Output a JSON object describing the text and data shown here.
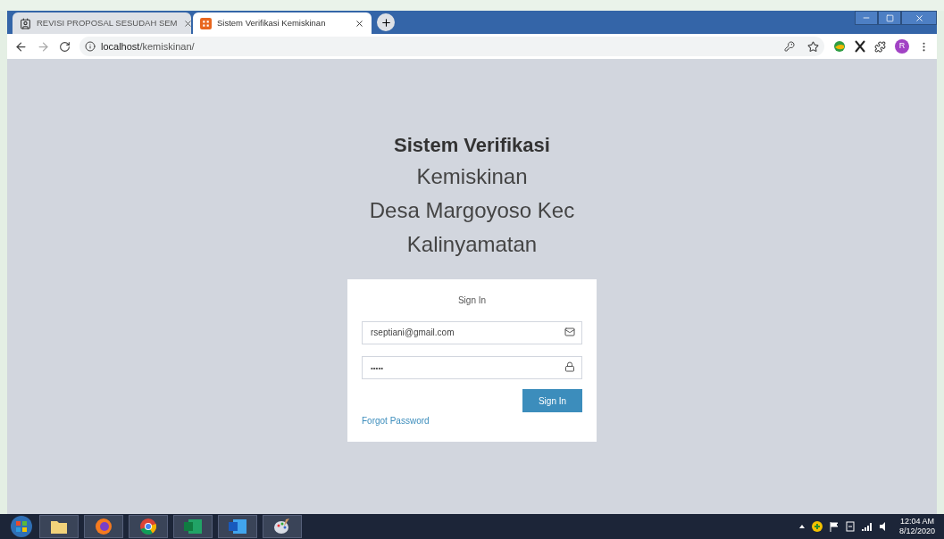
{
  "browser": {
    "tabs": [
      {
        "title": "REVISI PROPOSAL SESUDAH SEM",
        "selected": false
      },
      {
        "title": "Sistem Verifikasi Kemiskinan",
        "selected": true
      }
    ],
    "url_host": "localhost",
    "url_path": "/kemiskinan/",
    "profile_initial": "R"
  },
  "page": {
    "title_bold": "Sistem Verifikasi",
    "title_lines": [
      "Kemiskinan",
      "Desa Margoyoso Kec",
      "Kalinyamatan"
    ],
    "form": {
      "heading": "Sign In",
      "email": {
        "value": "rseptiani@gmail.com"
      },
      "password": {
        "value": "•••••"
      },
      "submit": "Sign In",
      "forgot_link": "Forgot Password"
    }
  },
  "taskbar": {
    "time": "12:04 AM",
    "date": "8/12/2020"
  }
}
